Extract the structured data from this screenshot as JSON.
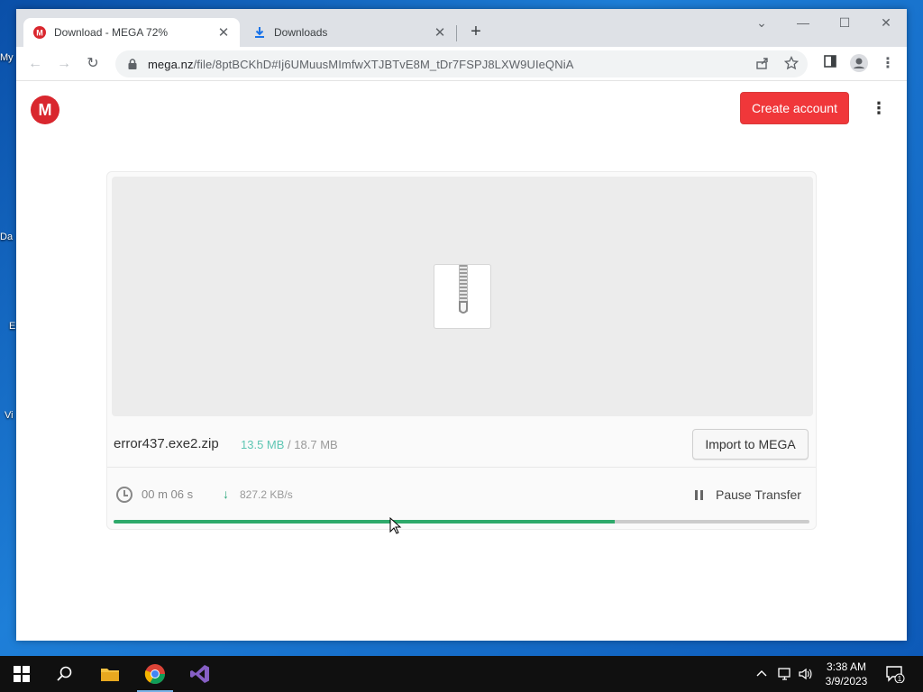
{
  "browser": {
    "tabs": [
      {
        "title": "Download - MEGA 72%",
        "active": true,
        "favicon": "mega-icon"
      },
      {
        "title": "Downloads",
        "active": false,
        "favicon": "download-icon"
      }
    ],
    "url_host": "mega.nz",
    "url_path": "/file/8ptBCKhD#Ij6UMuusMImfwXTJBTvE8M_tDr7FSPJ8LXW9UIeQNiA"
  },
  "page": {
    "logo": "M",
    "create_account": "Create account",
    "file_name": "error437.exe2.zip",
    "downloaded": "13.5 MB",
    "separator": "/",
    "total": "18.7 MB",
    "import_label": "Import to MEGA",
    "eta": "00 m  06 s",
    "speed": "827.2 KB/s",
    "pause_label": "Pause Transfer",
    "progress_percent": 72
  },
  "desktop": {
    "icons": [
      "My",
      "Da",
      "E",
      "Vi"
    ]
  },
  "taskbar": {
    "time": "3:38 AM",
    "date": "3/9/2023",
    "notifications": "1"
  },
  "colors": {
    "accent_red": "#f0373a",
    "progress_green": "#2eaa6b",
    "size_done_teal": "#5ec6b3"
  }
}
